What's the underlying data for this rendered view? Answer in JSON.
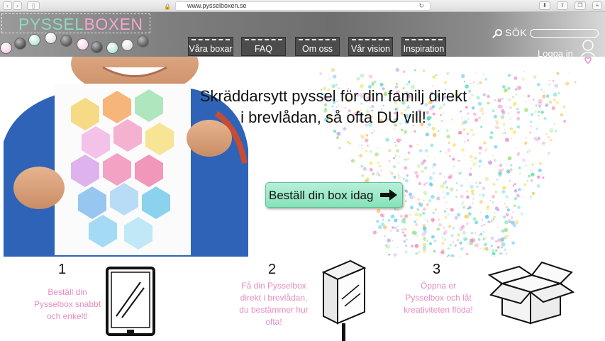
{
  "browser": {
    "url": "www.pysselboxen.se"
  },
  "header": {
    "logo_part1": "PYSSEL",
    "logo_part2": "BOXEN",
    "nav": [
      "Våra boxar",
      "FAQ",
      "Om oss",
      "Vår vision",
      "Inspiration"
    ],
    "search_label": "SÖK",
    "login_label": "Logga in"
  },
  "hero": {
    "headline_line1": "Skräddarsytt pyssel för din familj direkt",
    "headline_line2": "i brevlådan, så ofta DU vill!",
    "cta_label": "Beställ din box idag"
  },
  "steps": [
    {
      "number": "1",
      "lines": [
        "Beställ din",
        "Pysselbox snabbt",
        "och enkelt!"
      ]
    },
    {
      "number": "2",
      "lines": [
        "Få din Pysselbox",
        "direkt i brevlådan,",
        "du bestämmer hur",
        "ofta!"
      ]
    },
    {
      "number": "3",
      "lines": [
        "Öppna er",
        "Pysselbox och låt",
        "kreativiteten flöda!"
      ]
    }
  ],
  "colors": {
    "logo_green": "#8ed8c0",
    "logo_pink": "#f1a7cf",
    "step_text_pink": "#e78cc0",
    "cta_green": "#9ee8c8"
  }
}
